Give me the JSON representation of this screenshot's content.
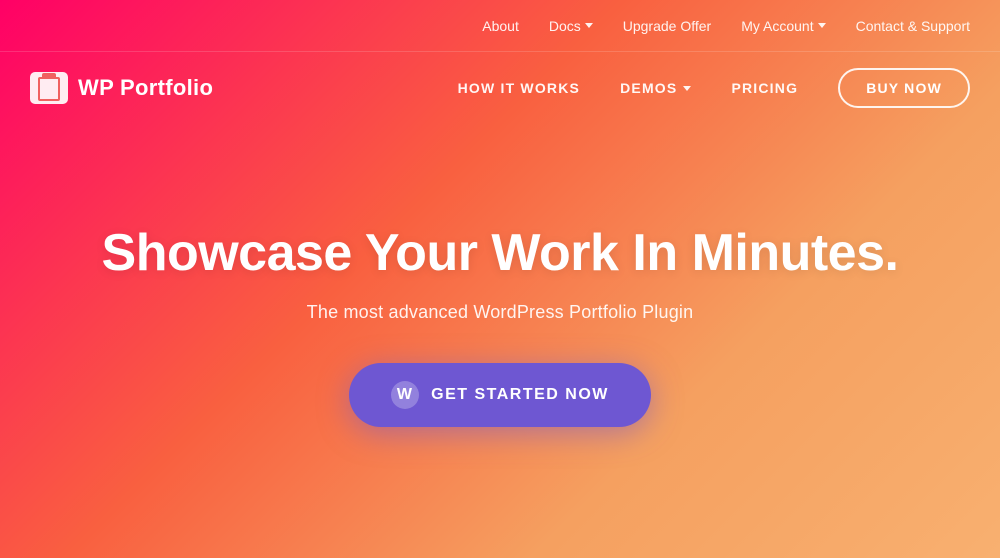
{
  "top_nav": {
    "items": [
      {
        "label": "About",
        "has_dropdown": false
      },
      {
        "label": "Docs",
        "has_dropdown": true
      },
      {
        "label": "Upgrade Offer",
        "has_dropdown": false
      },
      {
        "label": "My Account",
        "has_dropdown": true
      },
      {
        "label": "Contact & Support",
        "has_dropdown": false
      }
    ]
  },
  "main_nav": {
    "logo_text": "WP Portfolio",
    "links": [
      {
        "label": "HOW IT WORKS",
        "has_dropdown": false
      },
      {
        "label": "DEMOS",
        "has_dropdown": true
      },
      {
        "label": "PRICING",
        "has_dropdown": false
      }
    ],
    "buy_button": "BUY NOW"
  },
  "hero": {
    "title": "Showcase Your Work In Minutes.",
    "subtitle": "The most advanced WordPress Portfolio Plugin",
    "cta_label": "GET STARTED NOW"
  }
}
